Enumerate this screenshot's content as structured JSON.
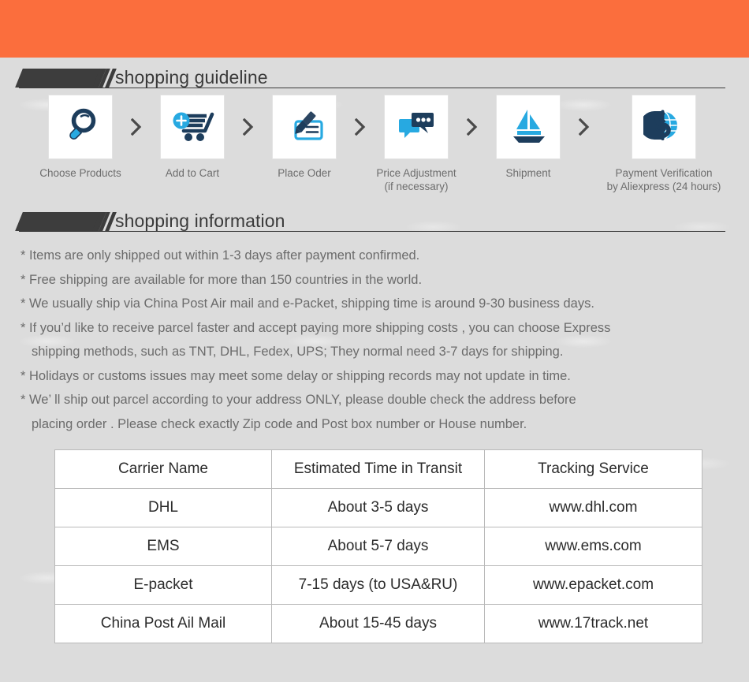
{
  "banner": {
    "color": "#fb6e3d"
  },
  "sections": {
    "guideline": {
      "title": "shopping guideline"
    },
    "information": {
      "title": "shopping information"
    }
  },
  "steps": [
    {
      "icon": "magnifier-icon",
      "label": "Choose Products"
    },
    {
      "icon": "add-to-cart-icon",
      "label": "Add to Cart"
    },
    {
      "icon": "pen-check-icon",
      "label": "Place Oder"
    },
    {
      "icon": "chat-bubbles-icon",
      "label": "Price Adjustment\n(if necessary)"
    },
    {
      "icon": "sailboat-icon",
      "label": "Shipment"
    },
    {
      "icon": "dollar-globe-icon",
      "label": "Payment Verification\nby  Aliexpress (24 hours)"
    }
  ],
  "step_separator": "chevron-right-icon",
  "info_lines": [
    {
      "text": "* Items are only shipped out within 1-3 days after payment confirmed.",
      "continuation": false
    },
    {
      "text": "* Free shipping are available for more than 150 countries in the world.",
      "continuation": false
    },
    {
      "text": "* We usually ship via China Post Air mail and e-Packet, shipping time is around 9-30 business days.",
      "continuation": false
    },
    {
      "text": "* If you’d like to receive parcel faster and accept paying more shipping costs , you can choose Express",
      "continuation": false
    },
    {
      "text": "shipping methods, such as TNT, DHL, Fedex, UPS; They normal need 3-7 days for shipping.",
      "continuation": true
    },
    {
      "text": "* Holidays or customs issues may meet some delay or shipping records may not update in time.",
      "continuation": false
    },
    {
      "text": "* We’ ll ship out parcel according to your address ONLY, please double check the address before",
      "continuation": false
    },
    {
      "text": "placing order . Please check exactly Zip code and Post box number or House number.",
      "continuation": true
    }
  ],
  "carrier_table": {
    "headers": [
      "Carrier Name",
      "Estimated Time in Transit",
      "Tracking Service"
    ],
    "rows": [
      [
        "DHL",
        "About 3-5 days",
        "www.dhl.com"
      ],
      [
        "EMS",
        "About 5-7 days",
        "www.ems.com"
      ],
      [
        "E-packet",
        "7-15 days (to USA&RU)",
        "www.epacket.com"
      ],
      [
        "China Post Ail Mail",
        "About 15-45 days",
        "www.17track.net"
      ]
    ]
  },
  "colors": {
    "accent_orange": "#fb6e3d",
    "icon_dark": "#1d3d5c",
    "icon_blue": "#27a9e1",
    "background": "#dcdcdc",
    "text_gray": "#6b6b6b",
    "heading_dark": "#3d3d3d"
  }
}
